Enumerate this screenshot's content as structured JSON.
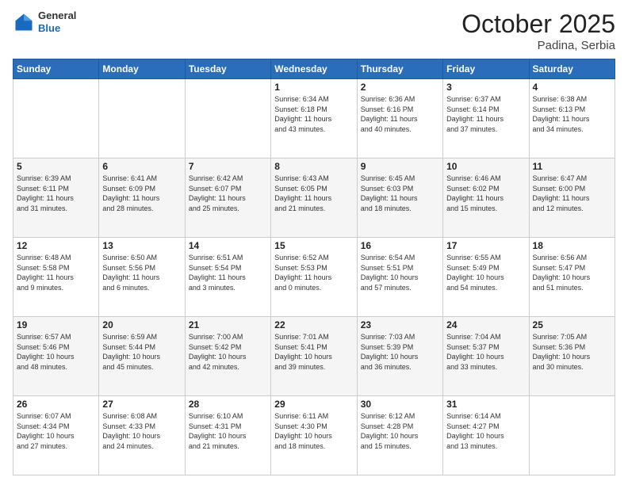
{
  "header": {
    "logo_general": "General",
    "logo_blue": "Blue",
    "month": "October 2025",
    "location": "Padina, Serbia"
  },
  "days_of_week": [
    "Sunday",
    "Monday",
    "Tuesday",
    "Wednesday",
    "Thursday",
    "Friday",
    "Saturday"
  ],
  "weeks": [
    [
      {
        "day": "",
        "info": ""
      },
      {
        "day": "",
        "info": ""
      },
      {
        "day": "",
        "info": ""
      },
      {
        "day": "1",
        "info": "Sunrise: 6:34 AM\nSunset: 6:18 PM\nDaylight: 11 hours\nand 43 minutes."
      },
      {
        "day": "2",
        "info": "Sunrise: 6:36 AM\nSunset: 6:16 PM\nDaylight: 11 hours\nand 40 minutes."
      },
      {
        "day": "3",
        "info": "Sunrise: 6:37 AM\nSunset: 6:14 PM\nDaylight: 11 hours\nand 37 minutes."
      },
      {
        "day": "4",
        "info": "Sunrise: 6:38 AM\nSunset: 6:13 PM\nDaylight: 11 hours\nand 34 minutes."
      }
    ],
    [
      {
        "day": "5",
        "info": "Sunrise: 6:39 AM\nSunset: 6:11 PM\nDaylight: 11 hours\nand 31 minutes."
      },
      {
        "day": "6",
        "info": "Sunrise: 6:41 AM\nSunset: 6:09 PM\nDaylight: 11 hours\nand 28 minutes."
      },
      {
        "day": "7",
        "info": "Sunrise: 6:42 AM\nSunset: 6:07 PM\nDaylight: 11 hours\nand 25 minutes."
      },
      {
        "day": "8",
        "info": "Sunrise: 6:43 AM\nSunset: 6:05 PM\nDaylight: 11 hours\nand 21 minutes."
      },
      {
        "day": "9",
        "info": "Sunrise: 6:45 AM\nSunset: 6:03 PM\nDaylight: 11 hours\nand 18 minutes."
      },
      {
        "day": "10",
        "info": "Sunrise: 6:46 AM\nSunset: 6:02 PM\nDaylight: 11 hours\nand 15 minutes."
      },
      {
        "day": "11",
        "info": "Sunrise: 6:47 AM\nSunset: 6:00 PM\nDaylight: 11 hours\nand 12 minutes."
      }
    ],
    [
      {
        "day": "12",
        "info": "Sunrise: 6:48 AM\nSunset: 5:58 PM\nDaylight: 11 hours\nand 9 minutes."
      },
      {
        "day": "13",
        "info": "Sunrise: 6:50 AM\nSunset: 5:56 PM\nDaylight: 11 hours\nand 6 minutes."
      },
      {
        "day": "14",
        "info": "Sunrise: 6:51 AM\nSunset: 5:54 PM\nDaylight: 11 hours\nand 3 minutes."
      },
      {
        "day": "15",
        "info": "Sunrise: 6:52 AM\nSunset: 5:53 PM\nDaylight: 11 hours\nand 0 minutes."
      },
      {
        "day": "16",
        "info": "Sunrise: 6:54 AM\nSunset: 5:51 PM\nDaylight: 10 hours\nand 57 minutes."
      },
      {
        "day": "17",
        "info": "Sunrise: 6:55 AM\nSunset: 5:49 PM\nDaylight: 10 hours\nand 54 minutes."
      },
      {
        "day": "18",
        "info": "Sunrise: 6:56 AM\nSunset: 5:47 PM\nDaylight: 10 hours\nand 51 minutes."
      }
    ],
    [
      {
        "day": "19",
        "info": "Sunrise: 6:57 AM\nSunset: 5:46 PM\nDaylight: 10 hours\nand 48 minutes."
      },
      {
        "day": "20",
        "info": "Sunrise: 6:59 AM\nSunset: 5:44 PM\nDaylight: 10 hours\nand 45 minutes."
      },
      {
        "day": "21",
        "info": "Sunrise: 7:00 AM\nSunset: 5:42 PM\nDaylight: 10 hours\nand 42 minutes."
      },
      {
        "day": "22",
        "info": "Sunrise: 7:01 AM\nSunset: 5:41 PM\nDaylight: 10 hours\nand 39 minutes."
      },
      {
        "day": "23",
        "info": "Sunrise: 7:03 AM\nSunset: 5:39 PM\nDaylight: 10 hours\nand 36 minutes."
      },
      {
        "day": "24",
        "info": "Sunrise: 7:04 AM\nSunset: 5:37 PM\nDaylight: 10 hours\nand 33 minutes."
      },
      {
        "day": "25",
        "info": "Sunrise: 7:05 AM\nSunset: 5:36 PM\nDaylight: 10 hours\nand 30 minutes."
      }
    ],
    [
      {
        "day": "26",
        "info": "Sunrise: 6:07 AM\nSunset: 4:34 PM\nDaylight: 10 hours\nand 27 minutes."
      },
      {
        "day": "27",
        "info": "Sunrise: 6:08 AM\nSunset: 4:33 PM\nDaylight: 10 hours\nand 24 minutes."
      },
      {
        "day": "28",
        "info": "Sunrise: 6:10 AM\nSunset: 4:31 PM\nDaylight: 10 hours\nand 21 minutes."
      },
      {
        "day": "29",
        "info": "Sunrise: 6:11 AM\nSunset: 4:30 PM\nDaylight: 10 hours\nand 18 minutes."
      },
      {
        "day": "30",
        "info": "Sunrise: 6:12 AM\nSunset: 4:28 PM\nDaylight: 10 hours\nand 15 minutes."
      },
      {
        "day": "31",
        "info": "Sunrise: 6:14 AM\nSunset: 4:27 PM\nDaylight: 10 hours\nand 13 minutes."
      },
      {
        "day": "",
        "info": ""
      }
    ]
  ]
}
